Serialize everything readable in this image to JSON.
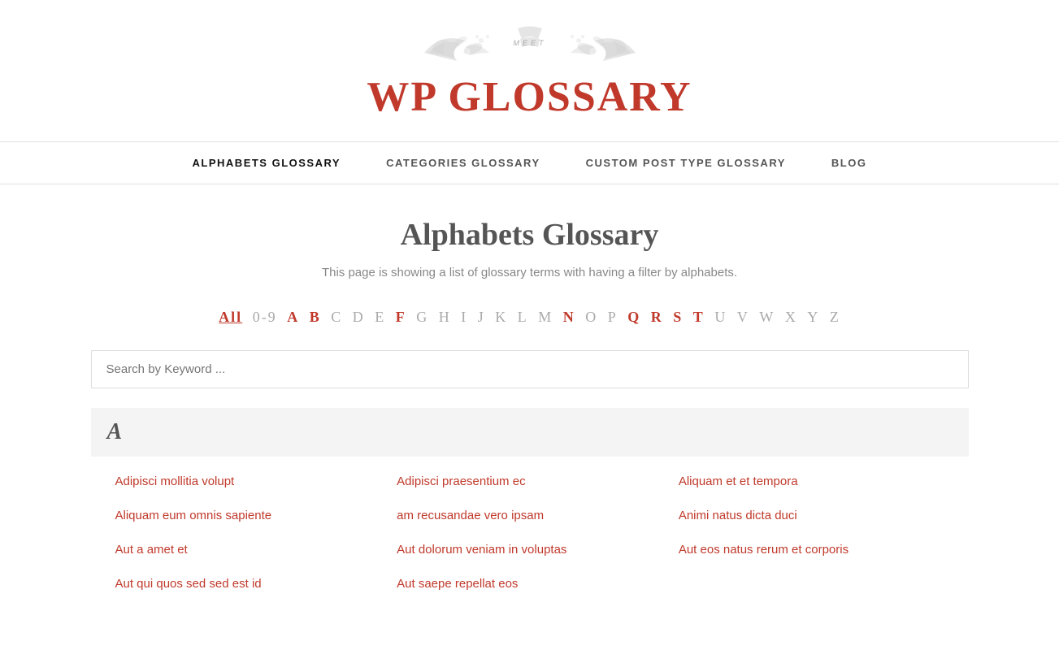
{
  "site": {
    "logo_meet": "MEET",
    "logo_title": "WP GLOSSARY"
  },
  "nav": {
    "items": [
      {
        "label": "ALPHABETS GLOSSARY",
        "active": true,
        "href": "#"
      },
      {
        "label": "CATEGORIES GLOSSARY",
        "active": false,
        "href": "#"
      },
      {
        "label": "CUSTOM POST TYPE GLOSSARY",
        "active": false,
        "href": "#"
      },
      {
        "label": "BLOG",
        "active": false,
        "href": "#"
      }
    ]
  },
  "page": {
    "title": "Alphabets Glossary",
    "subtitle": "This page is showing a list of glossary terms with having a filter by alphabets.",
    "search_placeholder": "Search by Keyword ..."
  },
  "alphabet_filter": {
    "items": [
      {
        "label": "All",
        "active": true,
        "has_entries": true
      },
      {
        "label": "0-9",
        "active": false,
        "has_entries": false
      },
      {
        "label": "A",
        "active": false,
        "has_entries": true
      },
      {
        "label": "B",
        "active": false,
        "has_entries": true
      },
      {
        "label": "C",
        "active": false,
        "has_entries": false
      },
      {
        "label": "D",
        "active": false,
        "has_entries": false
      },
      {
        "label": "E",
        "active": false,
        "has_entries": false
      },
      {
        "label": "F",
        "active": false,
        "has_entries": true
      },
      {
        "label": "G",
        "active": false,
        "has_entries": false
      },
      {
        "label": "H",
        "active": false,
        "has_entries": false
      },
      {
        "label": "I",
        "active": false,
        "has_entries": false
      },
      {
        "label": "J",
        "active": false,
        "has_entries": false
      },
      {
        "label": "K",
        "active": false,
        "has_entries": false
      },
      {
        "label": "L",
        "active": false,
        "has_entries": false
      },
      {
        "label": "M",
        "active": false,
        "has_entries": false
      },
      {
        "label": "N",
        "active": false,
        "has_entries": true
      },
      {
        "label": "O",
        "active": false,
        "has_entries": false
      },
      {
        "label": "P",
        "active": false,
        "has_entries": false
      },
      {
        "label": "Q",
        "active": false,
        "has_entries": true
      },
      {
        "label": "R",
        "active": false,
        "has_entries": true
      },
      {
        "label": "S",
        "active": false,
        "has_entries": true
      },
      {
        "label": "T",
        "active": false,
        "has_entries": true
      },
      {
        "label": "U",
        "active": false,
        "has_entries": false
      },
      {
        "label": "V",
        "active": false,
        "has_entries": false
      },
      {
        "label": "W",
        "active": false,
        "has_entries": false
      },
      {
        "label": "X",
        "active": false,
        "has_entries": false
      },
      {
        "label": "Y",
        "active": false,
        "has_entries": false
      },
      {
        "label": "Z",
        "active": false,
        "has_entries": false
      }
    ]
  },
  "sections": [
    {
      "letter": "A",
      "terms": [
        {
          "label": "Adipisci mollitia volupt",
          "href": "#"
        },
        {
          "label": "Adipisci praesentium ec",
          "href": "#"
        },
        {
          "label": "Aliquam et et tempora",
          "href": "#"
        },
        {
          "label": "Aliquam eum omnis sapiente",
          "href": "#"
        },
        {
          "label": "am recusandae vero ipsam",
          "href": "#"
        },
        {
          "label": "Animi natus dicta duci",
          "href": "#"
        },
        {
          "label": "Aut a amet et",
          "href": "#"
        },
        {
          "label": "Aut dolorum veniam in voluptas",
          "href": "#"
        },
        {
          "label": "Aut eos natus rerum et corporis",
          "href": "#"
        },
        {
          "label": "Aut qui quos sed sed est id",
          "href": "#"
        },
        {
          "label": "Aut saepe repellat eos",
          "href": "#"
        },
        {
          "label": "",
          "href": "#"
        }
      ]
    }
  ]
}
